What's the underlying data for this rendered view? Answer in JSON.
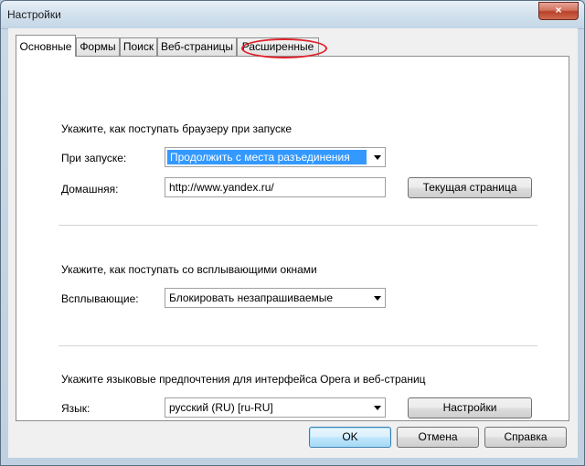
{
  "window": {
    "title": "Настройки",
    "close_glyph": "×"
  },
  "tabs": [
    {
      "label": "Основные",
      "active": true
    },
    {
      "label": "Формы",
      "active": false
    },
    {
      "label": "Поиск",
      "active": false
    },
    {
      "label": "Веб-страницы",
      "active": false
    },
    {
      "label": "Расширенные",
      "active": false,
      "highlighted": true
    }
  ],
  "startup": {
    "heading": "Укажите, как поступать браузеру при запуске",
    "on_start_label": "При запуске:",
    "on_start_value": "Продолжить с места разъединения",
    "home_label": "Домашняя:",
    "home_value": "http://www.yandex.ru/",
    "current_page_button": "Текущая страница"
  },
  "popups": {
    "heading": "Укажите, как поступать со всплывающими окнами",
    "label": "Всплывающие:",
    "value": "Блокировать незапрашиваемые"
  },
  "language": {
    "heading": "Укажите языковые предпочтения для интерфейса Opera и веб-страниц",
    "label": "Язык:",
    "value": "русский (RU) [ru-RU]",
    "settings_button": "Настройки"
  },
  "footer": {
    "ok": "OK",
    "cancel": "Отмена",
    "help": "Справка"
  },
  "colors": {
    "highlight": "#3399ff",
    "annotation": "#e0202a"
  }
}
